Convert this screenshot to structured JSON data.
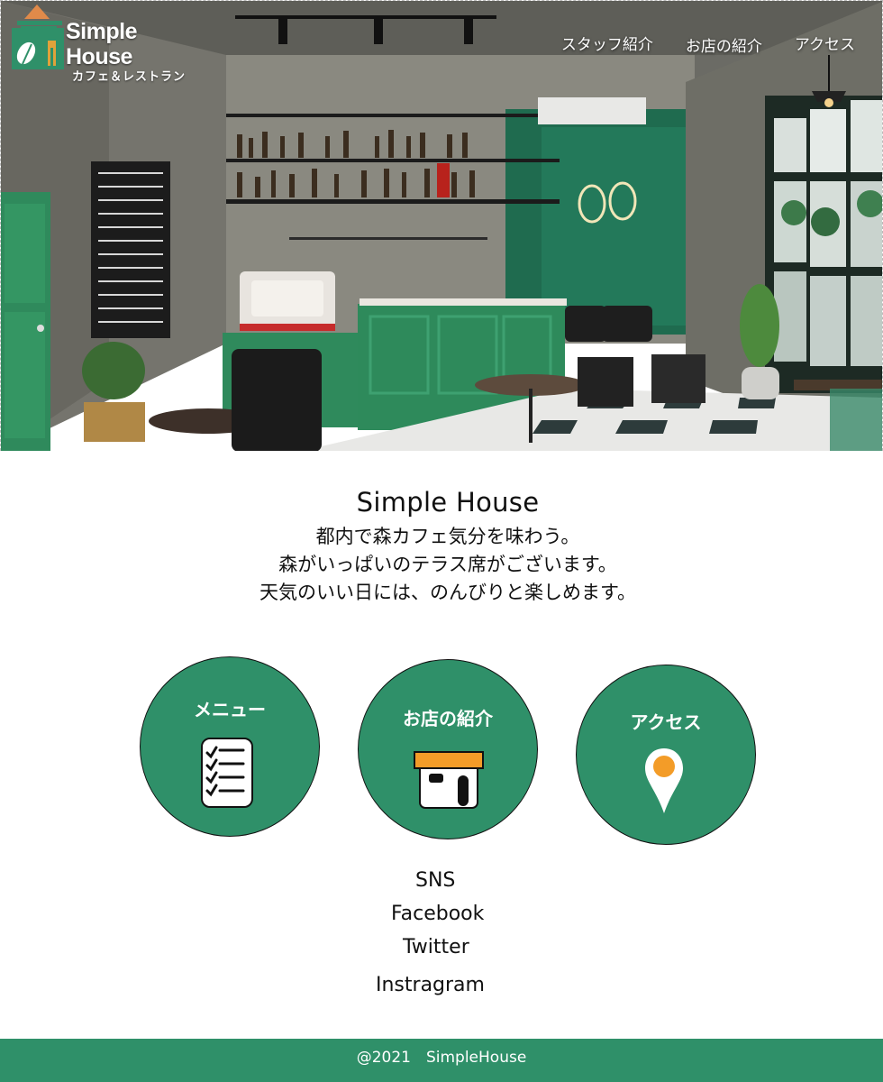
{
  "brand": {
    "title": "Simple House",
    "subtitle": "カフェ＆レストラン"
  },
  "nav": {
    "items": [
      {
        "label": "スタッフ紹介"
      },
      {
        "label": "お店の紹介"
      },
      {
        "label": "アクセス"
      }
    ]
  },
  "intro": {
    "heading": "Simple House",
    "lines": [
      "都内で森カフェ気分を味わう。",
      "森がいっぱいのテラス席がございます。",
      "天気のいい日には、のんびりと楽しめます。"
    ]
  },
  "features": [
    {
      "label": "メニュー",
      "icon": "checklist-icon"
    },
    {
      "label": "お店の紹介",
      "icon": "shop-icon"
    },
    {
      "label": "アクセス",
      "icon": "map-pin-icon"
    }
  ],
  "sns": {
    "title": "SNS",
    "links": [
      "Facebook",
      "Twitter",
      "Instragram"
    ]
  },
  "footer": {
    "copyright": "@2021　SimpleHouse"
  },
  "colors": {
    "brand_green": "#2f9069",
    "accent_orange": "#f39c28"
  }
}
